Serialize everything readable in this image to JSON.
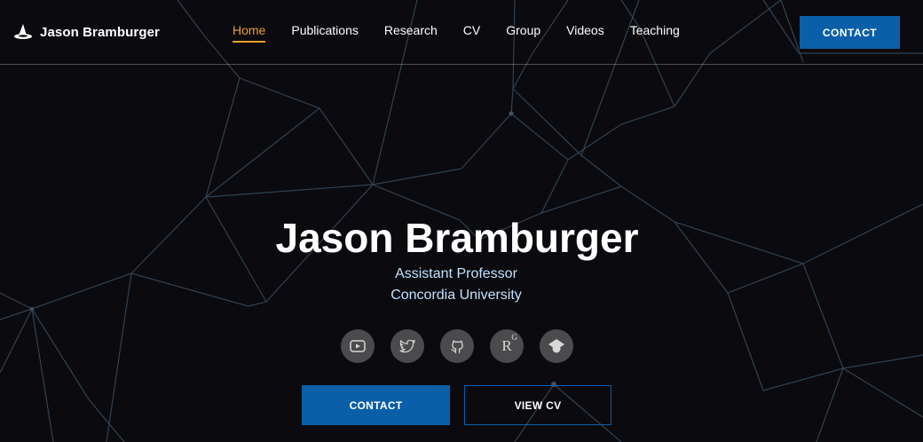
{
  "header": {
    "brand_name": "Jason Bramburger",
    "logo_icon": "wizard-hat-icon",
    "nav": [
      {
        "label": "Home",
        "active": true
      },
      {
        "label": "Publications",
        "active": false
      },
      {
        "label": "Research",
        "active": false
      },
      {
        "label": "CV",
        "active": false
      },
      {
        "label": "Group",
        "active": false
      },
      {
        "label": "Videos",
        "active": false
      },
      {
        "label": "Teaching",
        "active": false
      }
    ],
    "contact_label": "CONTACT"
  },
  "hero": {
    "name": "Jason Bramburger",
    "title": "Assistant Professor",
    "organization": "Concordia University",
    "socials": [
      {
        "icon": "youtube-icon"
      },
      {
        "icon": "twitter-icon"
      },
      {
        "icon": "github-icon"
      },
      {
        "icon": "researchgate-icon",
        "text": "R",
        "sup": "G"
      },
      {
        "icon": "google-scholar-icon"
      }
    ],
    "contact_button": "CONTACT",
    "cv_button": "VIEW CV"
  },
  "colors": {
    "background": "#0b0a0e",
    "accent_blue": "#0b5fa8",
    "active_nav": "#e8a030",
    "subtitle": "#bfe2ff",
    "network_lines": "#3a5064"
  }
}
